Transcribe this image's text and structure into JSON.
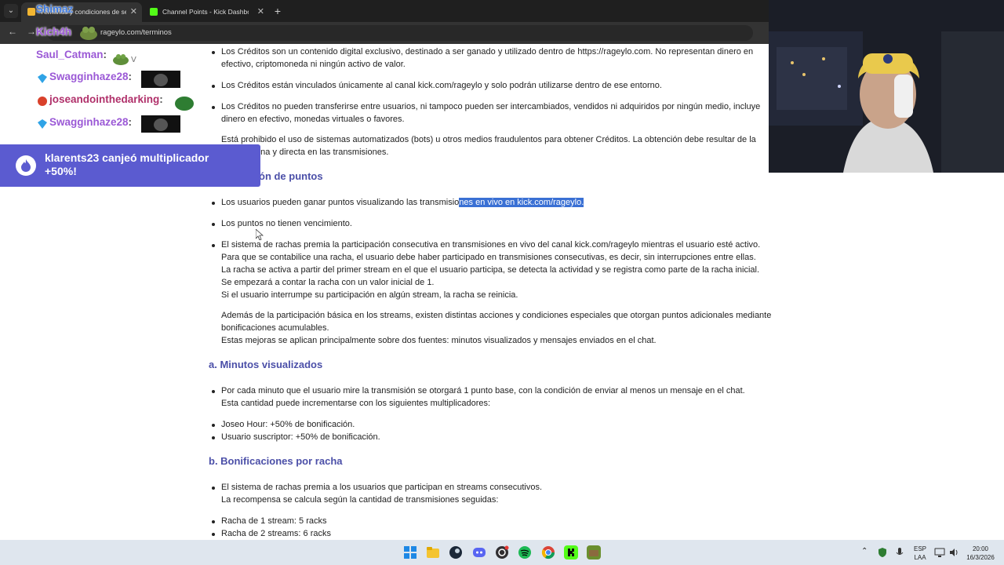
{
  "browser": {
    "tabs": [
      {
        "label": "Términos y condiciones de servicio",
        "active": true
      },
      {
        "label": "Channel Points - Kick Dashboard",
        "active": false
      }
    ],
    "url": "rageylo.com/terminos"
  },
  "page": {
    "items": [
      "Los Créditos son un contenido digital exclusivo, destinado a ser ganado y utilizado dentro de https://rageylo.com. No representan dinero en",
      "efectivo, criptomoneda ni ningún activo de valor.",
      "Los Créditos están vinculados únicamente al canal kick.com/rageylo y solo podrán utilizarse dentro de ese entorno.",
      "Los Créditos no pueden transferirse entre usuarios, ni tampoco pueden ser intercambiados, vendidos ni adquiridos por ningún medio, incluye",
      "dinero en efectivo, monedas virtuales o favores.",
      "Está prohibido el uso de sistemas automatizados (bots) u otros medios fraudulentos para obtener Créditos. La obtención debe resultar de la",
      "ción genuina y directa en las transmisiones."
    ],
    "heading_partial": "ón de puntos",
    "puntos": {
      "line1_pre": "Los usuarios pueden ganar puntos visualizando las transmisio",
      "line1_sel": "nes en vivo en kick.com/rageylo.",
      "line2": "Los puntos no tienen vencimiento.",
      "rachas": [
        "El sistema de rachas premia la participación consecutiva en transmisiones en vivo del canal kick.com/rageylo mientras el usuario esté activo.",
        "Para que se contabilice una racha, el usuario debe haber participado en transmisiones consecutivas, es decir, sin interrupciones entre ellas.",
        "La racha se activa a partir del primer stream en el que el usuario participa, se detecta la actividad y se registra como parte de la racha inicial.",
        "Se empezará a contar la racha con un valor inicial de 1.",
        "Si el usuario interrumpe su participación en algún stream, la racha se reinicia."
      ],
      "extra": [
        "Además de la participación básica en los streams, existen distintas acciones y condiciones especiales que otorgan puntos adicionales mediante",
        "bonificaciones acumulables.",
        "Estas mejoras se aplican principalmente sobre dos fuentes: minutos visualizados y mensajes enviados en el chat."
      ]
    },
    "minutos": {
      "heading": "a. Minutos visualizados",
      "lines": [
        "Por cada minuto que el usuario mire la transmisión se otorgará 1 punto base, con la condición de enviar al menos un mensaje en el chat.",
        "Esta cantidad puede incrementarse con los siguientes multiplicadores:"
      ],
      "mults": [
        "Joseo Hour: +50% de bonificación.",
        "Usuario suscriptor: +50% de bonificación."
      ]
    },
    "racha": {
      "heading": "b. Bonificaciones por racha",
      "lines": [
        "El sistema de rachas premia a los usuarios que participan en streams consecutivos.",
        "La recompensa se calcula según la cantidad de transmisiones seguidas:"
      ],
      "levels": [
        "Racha de 1 stream: 5 racks",
        "Racha de 2 streams: 6 racks"
      ]
    }
  },
  "chat": {
    "messages": [
      {
        "user": "Shimaz",
        "color": "#3f7be0"
      },
      {
        "user": "Kich4h",
        "color": "#9b59d6"
      },
      {
        "user": "Saul_Catman",
        "color": "#9b59d6"
      },
      {
        "user": "Swagginhaze28",
        "color": "#9b59d6"
      },
      {
        "user": "joseandointhedarking",
        "color": "#b0306a"
      },
      {
        "user": "Swagginhaze28",
        "color": "#9b59d6"
      }
    ],
    "redeem": {
      "line1": "klarents23 canjeó multiplicador",
      "line2": "+50%!"
    }
  },
  "taskbar": {
    "lang": "ESP",
    "lang2": "LAA",
    "time": "20:00",
    "date": "16/3/2026"
  },
  "colors": {
    "heading": "#4b4fa8",
    "selection": "#3a70d4",
    "redeem_bg": "#5b5bd0"
  }
}
